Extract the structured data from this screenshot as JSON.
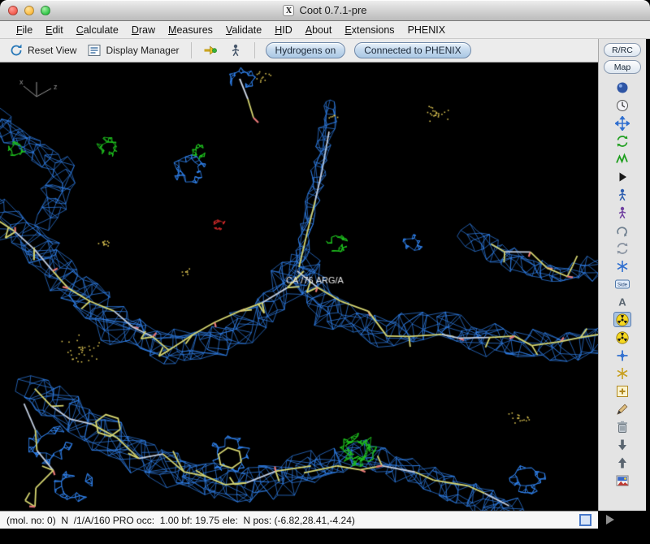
{
  "window": {
    "title": "Coot 0.7.1-pre",
    "icon_glyph": "X"
  },
  "menu_bar": {
    "items": [
      {
        "label": "File",
        "underline": true
      },
      {
        "label": "Edit",
        "underline": true
      },
      {
        "label": "Calculate",
        "underline": true
      },
      {
        "label": "Draw",
        "underline": true
      },
      {
        "label": "Measures",
        "underline": true
      },
      {
        "label": "Validate",
        "underline": true
      },
      {
        "label": "HID",
        "underline": true
      },
      {
        "label": "About",
        "underline": true
      },
      {
        "label": "Extensions",
        "underline": true
      },
      {
        "label": "PHENIX",
        "underline": false
      }
    ]
  },
  "toolbar": {
    "items": [
      {
        "name": "reset-view-button",
        "shape": "resetview",
        "label": "Reset View"
      },
      {
        "name": "display-manager-button",
        "shape": "displaymgr",
        "label": "Display Manager"
      },
      {
        "sep": true
      },
      {
        "name": "goto-atom-button",
        "shape": "gotoatom"
      },
      {
        "name": "goto-ligand-button",
        "shape": "figure",
        "color": "#48586c"
      },
      {
        "sep": true
      },
      {
        "name": "hydrogens-toggle",
        "pill": true,
        "label": "Hydrogens on"
      },
      {
        "name": "phenix-status-button",
        "pill": true,
        "label": "Connected to PHENIX"
      }
    ]
  },
  "right_panel": {
    "rrc_label": "R/RC",
    "map_label": "Map",
    "icons": [
      {
        "name": "sphere-icon",
        "shape": "sphere",
        "color": "#2e55a5"
      },
      {
        "name": "clock-icon",
        "shape": "clock",
        "color": "#e8e8ee"
      },
      {
        "name": "move-zone-icon",
        "shape": "move",
        "color": "#2f6fd0"
      },
      {
        "name": "real-space-refine-icon",
        "shape": "cycle",
        "color": "#1f9f1f"
      },
      {
        "name": "regularize-zone-icon",
        "shape": "zigzag",
        "color": "#1f9f1f"
      },
      {
        "name": "play-icon",
        "shape": "triangle",
        "color": "#1a1a1a"
      },
      {
        "name": "auto-fit-rotamer-icon",
        "shape": "figure",
        "color": "#2f5fb0"
      },
      {
        "name": "mutate-icon",
        "shape": "figure",
        "color": "#7040a0"
      },
      {
        "name": "pep-flip-icon",
        "shape": "loop",
        "color": "#708090"
      },
      {
        "name": "rotamers-icon",
        "shape": "cycle",
        "color": "#8892a0"
      },
      {
        "name": "edit-chi-angles-icon",
        "shape": "asterisk",
        "color": "#2f6fd0"
      },
      {
        "name": "side-chain-180-icon",
        "shape": "side",
        "label": "Side"
      },
      {
        "name": "add-terminal-residue-icon",
        "shape": "letterA",
        "label": "A",
        "color": "#5a6570"
      },
      {
        "name": "phenix-refine-icon",
        "shape": "radiation",
        "selected": true
      },
      {
        "name": "phenix-update-maps-icon",
        "shape": "radiation"
      },
      {
        "name": "flip-peptide-icon",
        "shape": "anchor-cross",
        "color": "#2f6fd0"
      },
      {
        "name": "add-alt-conf-icon",
        "shape": "asterisk",
        "color": "#c8a020"
      },
      {
        "name": "place-atom-icon",
        "shape": "plusbox",
        "color": "#b08820"
      },
      {
        "name": "pencil-icon",
        "shape": "pencil",
        "color": "#a07850"
      },
      {
        "name": "delete-item-icon",
        "shape": "trash",
        "color": "#7d8791"
      },
      {
        "name": "undo-icon",
        "shape": "arrowdown",
        "color": "#5a6570"
      },
      {
        "name": "redo-icon",
        "shape": "arrowup",
        "color": "#5a6570"
      },
      {
        "name": "phenix-logo-icon",
        "shape": "picture",
        "color": "#3868c8"
      }
    ]
  },
  "viewport": {
    "residue_label": "CA /76 ARG/A",
    "axis_labels": [
      "x",
      "z"
    ],
    "colors": {
      "background": "#000000",
      "density_2fofc": "#2f7fe8",
      "density_fofc_pos": "#1fbf1f",
      "density_fofc_neg": "#c62828",
      "carbon": "#d4d470",
      "nitrogen_bond": "#c0ccdf",
      "oxygen_stub": "#e87878",
      "dots": "#d8c050",
      "label": "#e8e8e8",
      "axes": "#9a9a9a"
    }
  },
  "status_bar": {
    "text": "(mol. no: 0)  N  /1/A/160 PRO occ:  1.00 bf: 19.75 ele:  N pos: (-6.82,28.41,-4.24)"
  }
}
